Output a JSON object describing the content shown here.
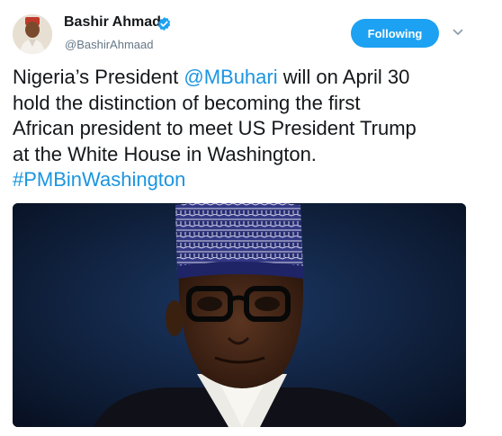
{
  "tweet": {
    "author": {
      "display_name": "Bashir Ahmad",
      "handle": "@BashirAhmaad",
      "verified_icon": "verified-badge-icon",
      "avatar_icon": "avatar"
    },
    "follow_button_label": "Following",
    "more_icon": "chevron-down-icon",
    "text_lines": {
      "line1_pre": "Nigeria’s President ",
      "line1_mention": "@MBuhari",
      "line1_post": " will on April 30",
      "line2": "hold the distinction of becoming the first",
      "line3": "African president to meet US President Trump",
      "line4": "at the White House in Washington.",
      "hashtag": "#PMBinWashington"
    },
    "colors": {
      "accent": "#1da1f2",
      "link": "#1b95e0",
      "text": "#14171a",
      "secondary": "#657786"
    }
  }
}
